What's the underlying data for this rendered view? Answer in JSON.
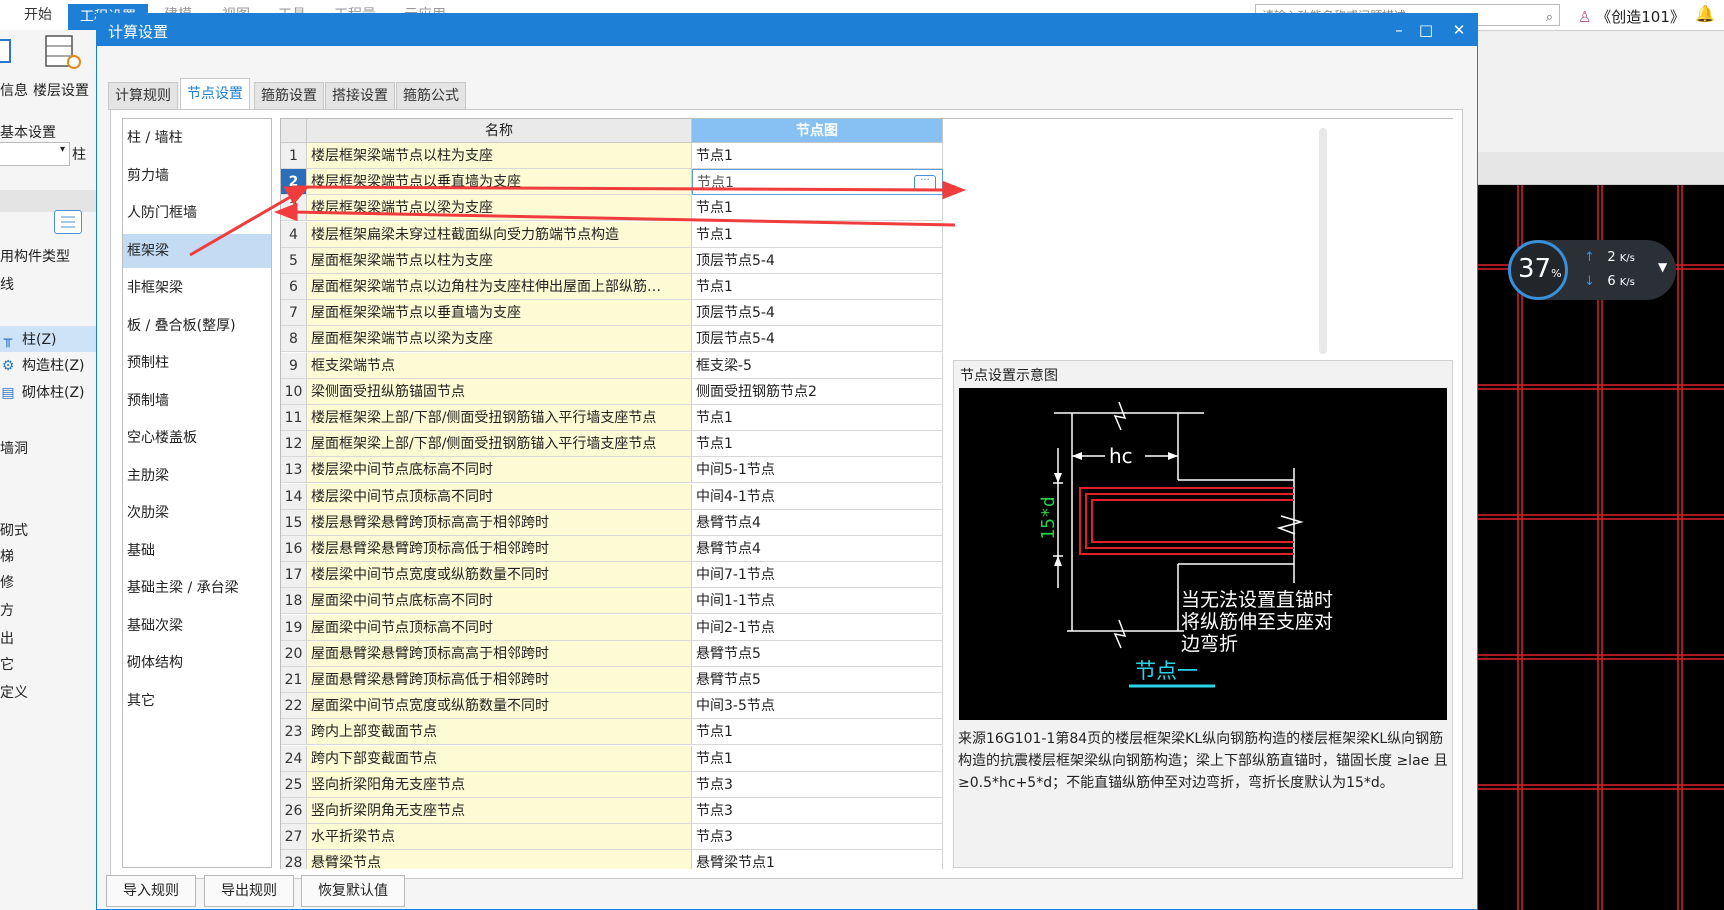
{
  "app": {
    "menu_tabs": [
      "开始",
      "工程设置",
      "建模",
      "视图",
      "工具",
      "工程量",
      "云应用"
    ],
    "search_placeholder": "请输入功能名称或问题描述",
    "user": "《创造101》",
    "ribbon": {
      "item1": "信息",
      "item2": "楼层设置",
      "group": "基本设置"
    },
    "left_panel": {
      "combo_right": "柱",
      "items": [
        "用构件类型",
        "线",
        "柱(Z)",
        "构造柱(Z)",
        "砌体柱(Z)",
        "墙洞",
        "砌式",
        "梯",
        "修",
        "方",
        "出",
        "它",
        "定义"
      ]
    }
  },
  "speed": {
    "percent": "37",
    "unit": "%",
    "up": "2",
    "down": "6",
    "rate_unit": "K/s"
  },
  "dialog": {
    "title": "计算设置",
    "tabs": [
      "计算规则",
      "节点设置",
      "箍筋设置",
      "搭接设置",
      "箍筋公式"
    ],
    "active_tab": 1,
    "categories": [
      "柱 / 墙柱",
      "剪力墙",
      "人防门框墙",
      "框架梁",
      "非框架梁",
      "板 / 叠合板(整厚)",
      "预制柱",
      "预制墙",
      "空心楼盖板",
      "主肋梁",
      "次肋梁",
      "基础",
      "基础主梁 / 承台梁",
      "基础次梁",
      "砌体结构",
      "其它"
    ],
    "active_category": 3,
    "grid": {
      "col_name": "名称",
      "col_node": "节点图",
      "selected_row": 1,
      "rows": [
        {
          "num": "1",
          "name": "楼层框架梁端节点以柱为支座",
          "node": "节点1"
        },
        {
          "num": "2",
          "name": "楼层框架梁端节点以垂直墙为支座",
          "node": "节点1"
        },
        {
          "num": "3",
          "name": "楼层框架梁端节点以梁为支座",
          "node": "节点1"
        },
        {
          "num": "4",
          "name": "楼层框架扁梁未穿过柱截面纵向受力筋端节点构造",
          "node": "节点1"
        },
        {
          "num": "5",
          "name": "屋面框架梁端节点以柱为支座",
          "node": "顶层节点5-4"
        },
        {
          "num": "6",
          "name": "屋面框架梁端节点以边角柱为支座柱伸出屋面上部纵筋…",
          "node": "节点1"
        },
        {
          "num": "7",
          "name": "屋面框架梁端节点以垂直墙为支座",
          "node": "顶层节点5-4"
        },
        {
          "num": "8",
          "name": "屋面框架梁端节点以梁为支座",
          "node": "顶层节点5-4"
        },
        {
          "num": "9",
          "name": "框支梁端节点",
          "node": "框支梁-5"
        },
        {
          "num": "10",
          "name": "梁侧面受扭纵筋锚固节点",
          "node": "侧面受扭钢筋节点2"
        },
        {
          "num": "11",
          "name": "楼层框架梁上部/下部/侧面受扭钢筋锚入平行墙支座节点",
          "node": "节点1"
        },
        {
          "num": "12",
          "name": "屋面框架梁上部/下部/侧面受扭钢筋锚入平行墙支座节点",
          "node": "节点1"
        },
        {
          "num": "13",
          "name": "楼层梁中间节点底标高不同时",
          "node": "中间5-1节点"
        },
        {
          "num": "14",
          "name": "楼层梁中间节点顶标高不同时",
          "node": "中间4-1节点"
        },
        {
          "num": "15",
          "name": "楼层悬臂梁悬臂跨顶标高高于相邻跨时",
          "node": "悬臂节点4"
        },
        {
          "num": "16",
          "name": "楼层悬臂梁悬臂跨顶标高低于相邻跨时",
          "node": "悬臂节点4"
        },
        {
          "num": "17",
          "name": "楼层梁中间节点宽度或纵筋数量不同时",
          "node": "中间7-1节点"
        },
        {
          "num": "18",
          "name": "屋面梁中间节点底标高不同时",
          "node": "中间1-1节点"
        },
        {
          "num": "19",
          "name": "屋面梁中间节点顶标高不同时",
          "node": "中间2-1节点"
        },
        {
          "num": "20",
          "name": "屋面悬臂梁悬臂跨顶标高高于相邻跨时",
          "node": "悬臂节点5"
        },
        {
          "num": "21",
          "name": "屋面悬臂梁悬臂跨顶标高低于相邻跨时",
          "node": "悬臂节点5"
        },
        {
          "num": "22",
          "name": "屋面梁中间节点宽度或纵筋数量不同时",
          "node": "中间3-5节点"
        },
        {
          "num": "23",
          "name": "跨内上部变截面节点",
          "node": "节点1"
        },
        {
          "num": "24",
          "name": "跨内下部变截面节点",
          "node": "节点1"
        },
        {
          "num": "25",
          "name": "竖向折梁阳角无支座节点",
          "node": "节点3"
        },
        {
          "num": "26",
          "name": "竖向折梁阴角无支座节点",
          "node": "节点3"
        },
        {
          "num": "27",
          "name": "水平折梁节点",
          "node": "节点3"
        },
        {
          "num": "28",
          "name": "悬臂梁节点",
          "node": "悬臂梁节点1"
        }
      ],
      "ellipsis": "···"
    },
    "preview": {
      "title": "节点设置示意图",
      "diagram_hc": "hc",
      "diagram_15d": "15*d",
      "diagram_note": [
        "当无法设置直锚时",
        "将纵筋伸至支座对",
        "边弯折"
      ],
      "diagram_caption": "节点一",
      "description": "来源16G101-1第84页的楼层框架梁KL纵向钢筋构造的楼层框架梁KL纵向钢筋构造的抗震楼层框架梁纵向钢筋构造；梁上下部纵筋直锚时，锚固长度 ≥lae 且 ≥0.5*hc+5*d；不能直锚纵筋伸至对边弯折，弯折长度默认为15*d。"
    },
    "buttons": [
      "导入规则",
      "导出规则",
      "恢复默认值"
    ],
    "window_controls": {
      "minimize": "–",
      "maximize": "□",
      "close": "✕"
    }
  },
  "colors": {
    "accent": "#1e7fd6",
    "annotation": "#f03c3c",
    "name_cell": "#fdfbd4",
    "cad_red": "#e0202a"
  }
}
